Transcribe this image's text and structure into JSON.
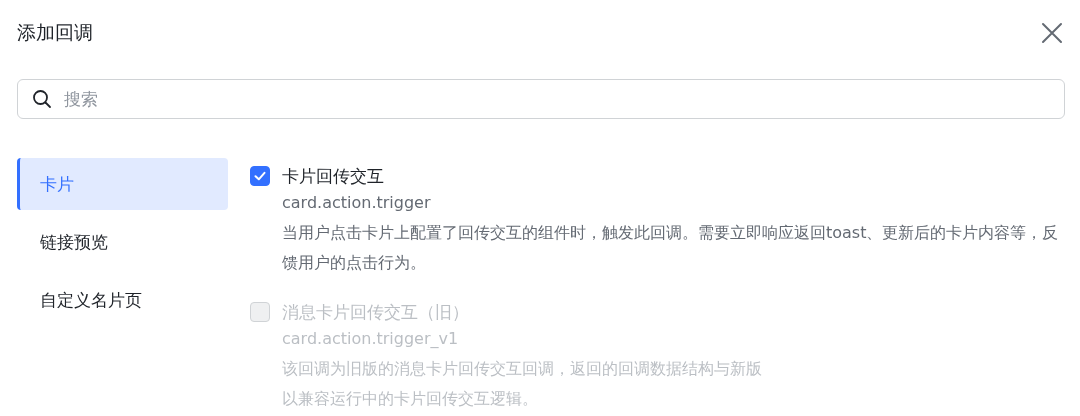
{
  "dialog": {
    "title": "添加回调"
  },
  "search": {
    "placeholder": "搜索"
  },
  "sidebar": {
    "items": [
      {
        "label": "卡片",
        "selected": true
      },
      {
        "label": "链接预览",
        "selected": false
      },
      {
        "label": "自定义名片页",
        "selected": false
      }
    ]
  },
  "callbacks": [
    {
      "title": "卡片回传交互",
      "code": "card.action.trigger",
      "description": [
        "当用户点击卡片上配置了回传交互的组件时，触发此回调。需要立即响应返回toast、更新后的卡片内容等，反馈用户的点击行为。"
      ],
      "checked": true,
      "disabled": false
    },
    {
      "title": "消息卡片回传交互（旧）",
      "code": "card.action.trigger_v1",
      "description": [
        "该回调为旧版的消息卡片回传交互回调，返回的回调数据结构与新版",
        "以兼容运行中的卡片回传交互逻辑。"
      ],
      "checked": false,
      "disabled": true
    }
  ]
}
